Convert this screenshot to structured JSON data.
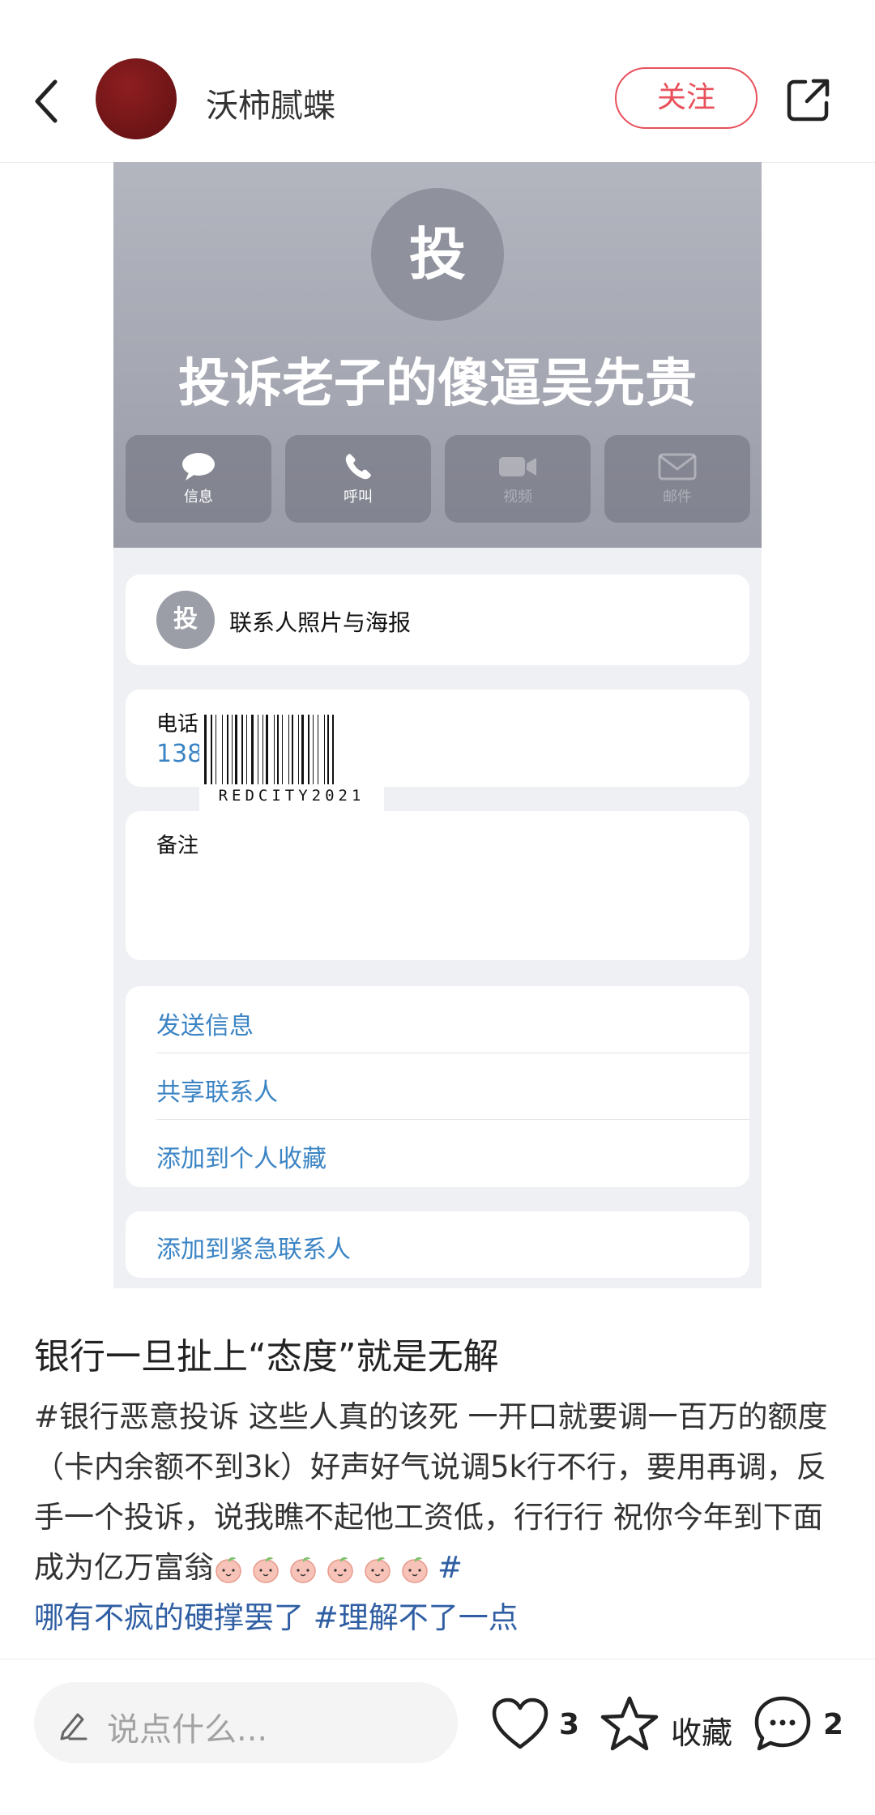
{
  "header": {
    "author": "沃柿腻蝶",
    "follow_label": "关注"
  },
  "photo": {
    "avatar_char": "投",
    "contact_name": "投诉老子的傻逼吴先贵",
    "actions": [
      {
        "label": "信息",
        "icon": "message-icon"
      },
      {
        "label": "呼叫",
        "icon": "phone-icon"
      },
      {
        "label": "视频",
        "icon": "video-icon"
      },
      {
        "label": "邮件",
        "icon": "mail-icon"
      }
    ],
    "poster_avatar_char": "投",
    "poster_label": "联系人照片与海报",
    "phone_label": "电话",
    "phone_value": "138",
    "watermark": "REDCITY2021",
    "notes_label": "备注",
    "options": [
      "发送信息",
      "共享联系人",
      "添加到个人收藏"
    ],
    "emergency": "添加到紧急联系人"
  },
  "post": {
    "title": "银行一旦扯上“态度”就是无解",
    "body_plain": "#银行恶意投诉 这些人真的该死 一开口就要调一百万的额度（卡内余额不到3k）好声好气说调5k行不行，要用再调，反手一个投诉，说我瞧不起他工资低，行行行 祝你今年到下面成为亿万富翁",
    "tag1": "#",
    "tag2": "哪有不疯的硬撑罢了",
    "tag3": "#理解不了一点"
  },
  "bottom": {
    "placeholder": "说点什么...",
    "like_count": "3",
    "collect_label": "收藏",
    "comment_count": "2"
  }
}
